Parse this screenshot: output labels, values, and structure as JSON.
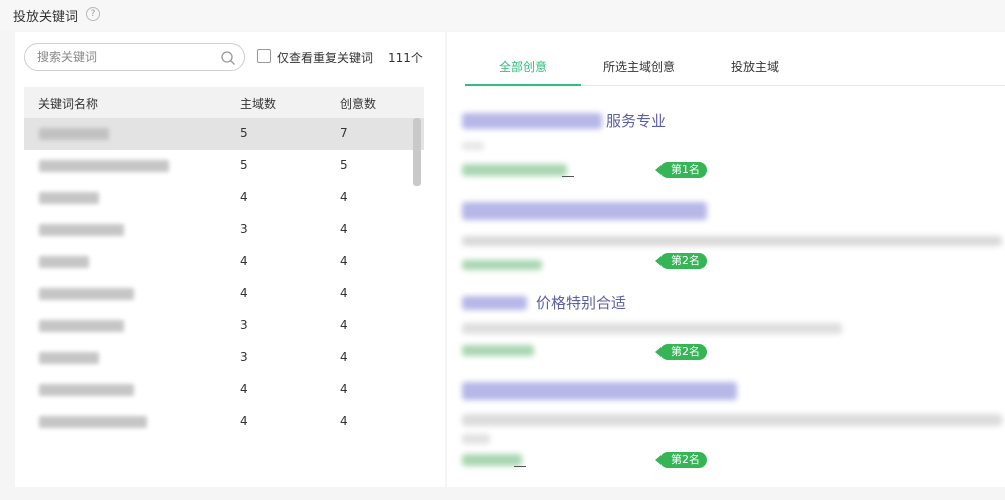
{
  "header": {
    "title": "投放关键词",
    "help_icon": "question-circle-icon"
  },
  "left": {
    "search_placeholder": "搜索关键词",
    "search_icon": "search-icon",
    "checkbox_label": "仅查看重复关键词",
    "checkbox_checked": false,
    "count": "111个",
    "columns": [
      "关键词名称",
      "主域数",
      "创意数"
    ],
    "rows": [
      {
        "domains": "5",
        "creatives": "7",
        "selected": true
      },
      {
        "domains": "5",
        "creatives": "5"
      },
      {
        "domains": "4",
        "creatives": "4"
      },
      {
        "domains": "3",
        "creatives": "4"
      },
      {
        "domains": "4",
        "creatives": "4"
      },
      {
        "domains": "4",
        "creatives": "4"
      },
      {
        "domains": "3",
        "creatives": "4"
      },
      {
        "domains": "3",
        "creatives": "4"
      },
      {
        "domains": "4",
        "creatives": "4"
      },
      {
        "domains": "4",
        "creatives": "4"
      }
    ]
  },
  "right": {
    "tabs": [
      "全部创意",
      "所选主域创意",
      "投放主域"
    ],
    "active_tab": 0,
    "items": [
      {
        "title": "服务专业",
        "rank": "第1名"
      },
      {
        "title": "",
        "rank": "第2名"
      },
      {
        "title": "价格特别合适",
        "rank": "第2名"
      },
      {
        "title": "",
        "rank": "第2名"
      }
    ]
  },
  "colors": {
    "accent": "#2fc07c",
    "rank_badge": "#35b556",
    "title_link": "#5b5fa6"
  }
}
